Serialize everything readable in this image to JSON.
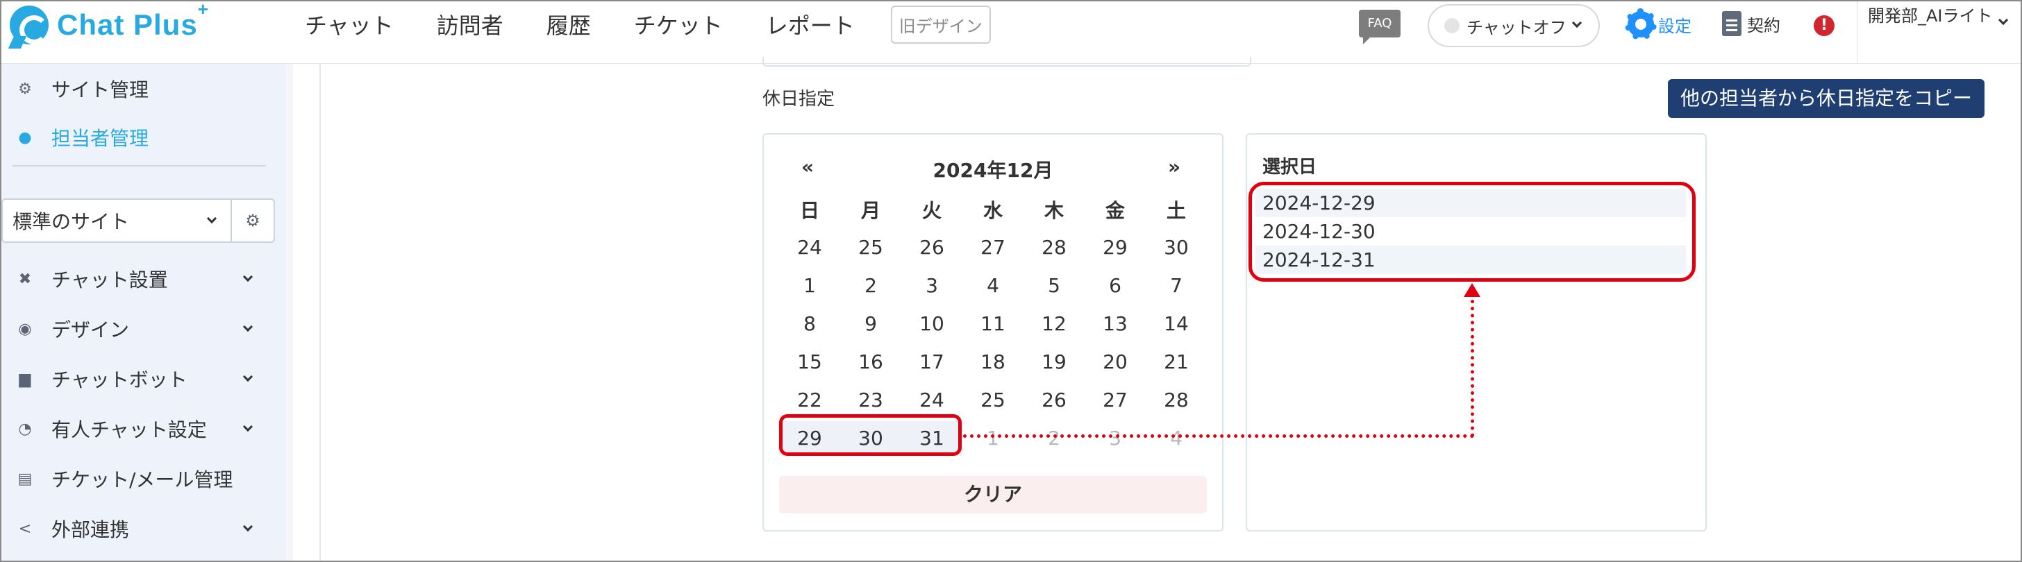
{
  "header": {
    "logo_text": "Chat Plus",
    "logo_plus": "+",
    "nav": [
      "チャット",
      "訪問者",
      "履歴",
      "チケット",
      "レポート"
    ],
    "old_design": "旧デザイン",
    "faq": "FAQ",
    "chat_status": "チャットオフ",
    "settings": "設定",
    "contract": "契約",
    "alert": "!",
    "user": "開発部_AIライト"
  },
  "sidebar": {
    "top_items": [
      {
        "label": "サイト管理",
        "icon": "gear-icon"
      },
      {
        "label": "担当者管理",
        "icon": "user-settings-icon"
      }
    ],
    "site_select": "標準のサイト",
    "items": [
      {
        "label": "チャット設置",
        "icon": "tools-icon"
      },
      {
        "label": "デザイン",
        "icon": "palette-icon"
      },
      {
        "label": "チャットボット",
        "icon": "chat-bubble-icon"
      },
      {
        "label": "有人チャット設定",
        "icon": "headset-icon"
      },
      {
        "label": "チケット/メール管理",
        "icon": "ticket-icon"
      },
      {
        "label": "外部連携",
        "icon": "share-icon"
      }
    ]
  },
  "main": {
    "section_label": "休日指定",
    "copy_button": "他の担当者から休日指定をコピー",
    "calendar": {
      "prev": "«",
      "next": "»",
      "title": "2024年12月",
      "weekdays": [
        "日",
        "月",
        "火",
        "水",
        "木",
        "金",
        "土"
      ],
      "weeks": [
        [
          "24",
          "25",
          "26",
          "27",
          "28",
          "29",
          "30"
        ],
        [
          "1",
          "2",
          "3",
          "4",
          "5",
          "6",
          "7"
        ],
        [
          "8",
          "9",
          "10",
          "11",
          "12",
          "13",
          "14"
        ],
        [
          "15",
          "16",
          "17",
          "18",
          "19",
          "20",
          "21"
        ],
        [
          "22",
          "23",
          "24",
          "25",
          "26",
          "27",
          "28"
        ],
        [
          "29",
          "30",
          "31",
          "1",
          "2",
          "3",
          "4"
        ]
      ],
      "clear_button": "クリア"
    },
    "selected": {
      "title": "選択日",
      "dates": [
        "2024-12-29",
        "2024-12-30",
        "2024-12-31"
      ]
    }
  },
  "colors": {
    "brand": "#29a9e1",
    "copy_button_bg": "#1f3f73",
    "annotation": "#e0000f"
  }
}
